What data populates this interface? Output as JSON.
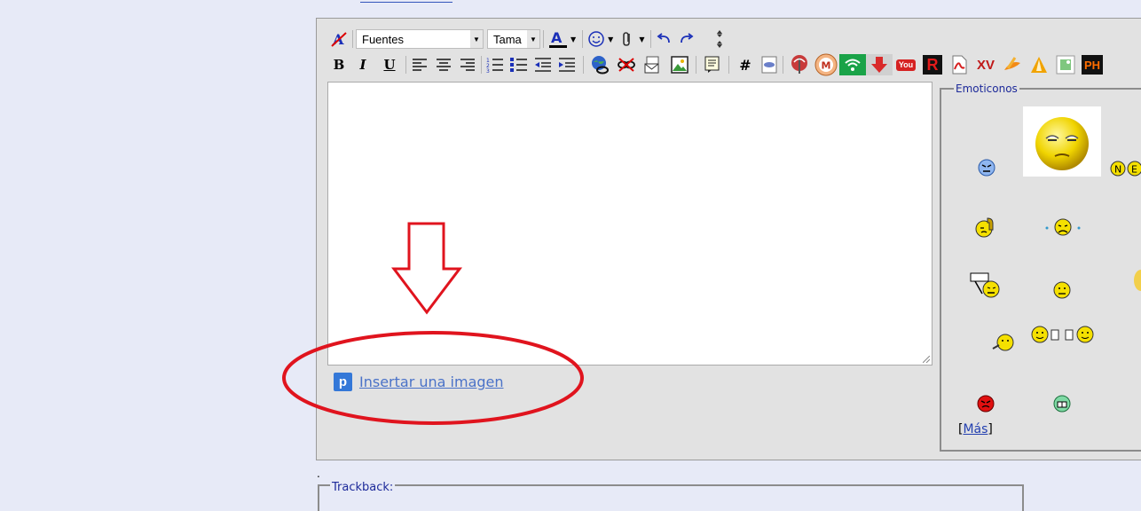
{
  "toolbar": {
    "font_select": "Fuentes",
    "size_select": "Tama",
    "row1": [
      "remove-format",
      "font-family",
      "font-size",
      "font-color",
      "emoticon",
      "attachment",
      "undo",
      "redo",
      "toggle-size"
    ],
    "row2": [
      "bold",
      "italic",
      "underline",
      "align-left",
      "align-center",
      "align-right",
      "ordered-list",
      "unordered-list",
      "outdent",
      "indent",
      "link",
      "unlink",
      "email",
      "image",
      "quote",
      "hash",
      "php",
      "fav",
      "mega",
      "wifi",
      "down",
      "youtube",
      "r",
      "pdf",
      "xv",
      "vlc",
      "warning",
      "img",
      "ph"
    ]
  },
  "labels": {
    "bold": "B",
    "italic": "I",
    "underline": "U",
    "hash": "#",
    "youtube": "You",
    "r": "R",
    "xv": "XV",
    "ph": "PH"
  },
  "insert_image": {
    "icon_letter": "p",
    "label": "Insertar una imagen"
  },
  "emoticons": {
    "title": "Emoticonos",
    "more_open": "[",
    "more_label": "Más",
    "more_close": "]"
  },
  "trackback": {
    "title": "Trackback:"
  },
  "dot": ".",
  "colors": {
    "background": "#e7eaf7",
    "panel": "#e2e2e2",
    "link": "#4a72c8",
    "annotation": "#e0141e",
    "legend_text": "#1d2a9a"
  }
}
